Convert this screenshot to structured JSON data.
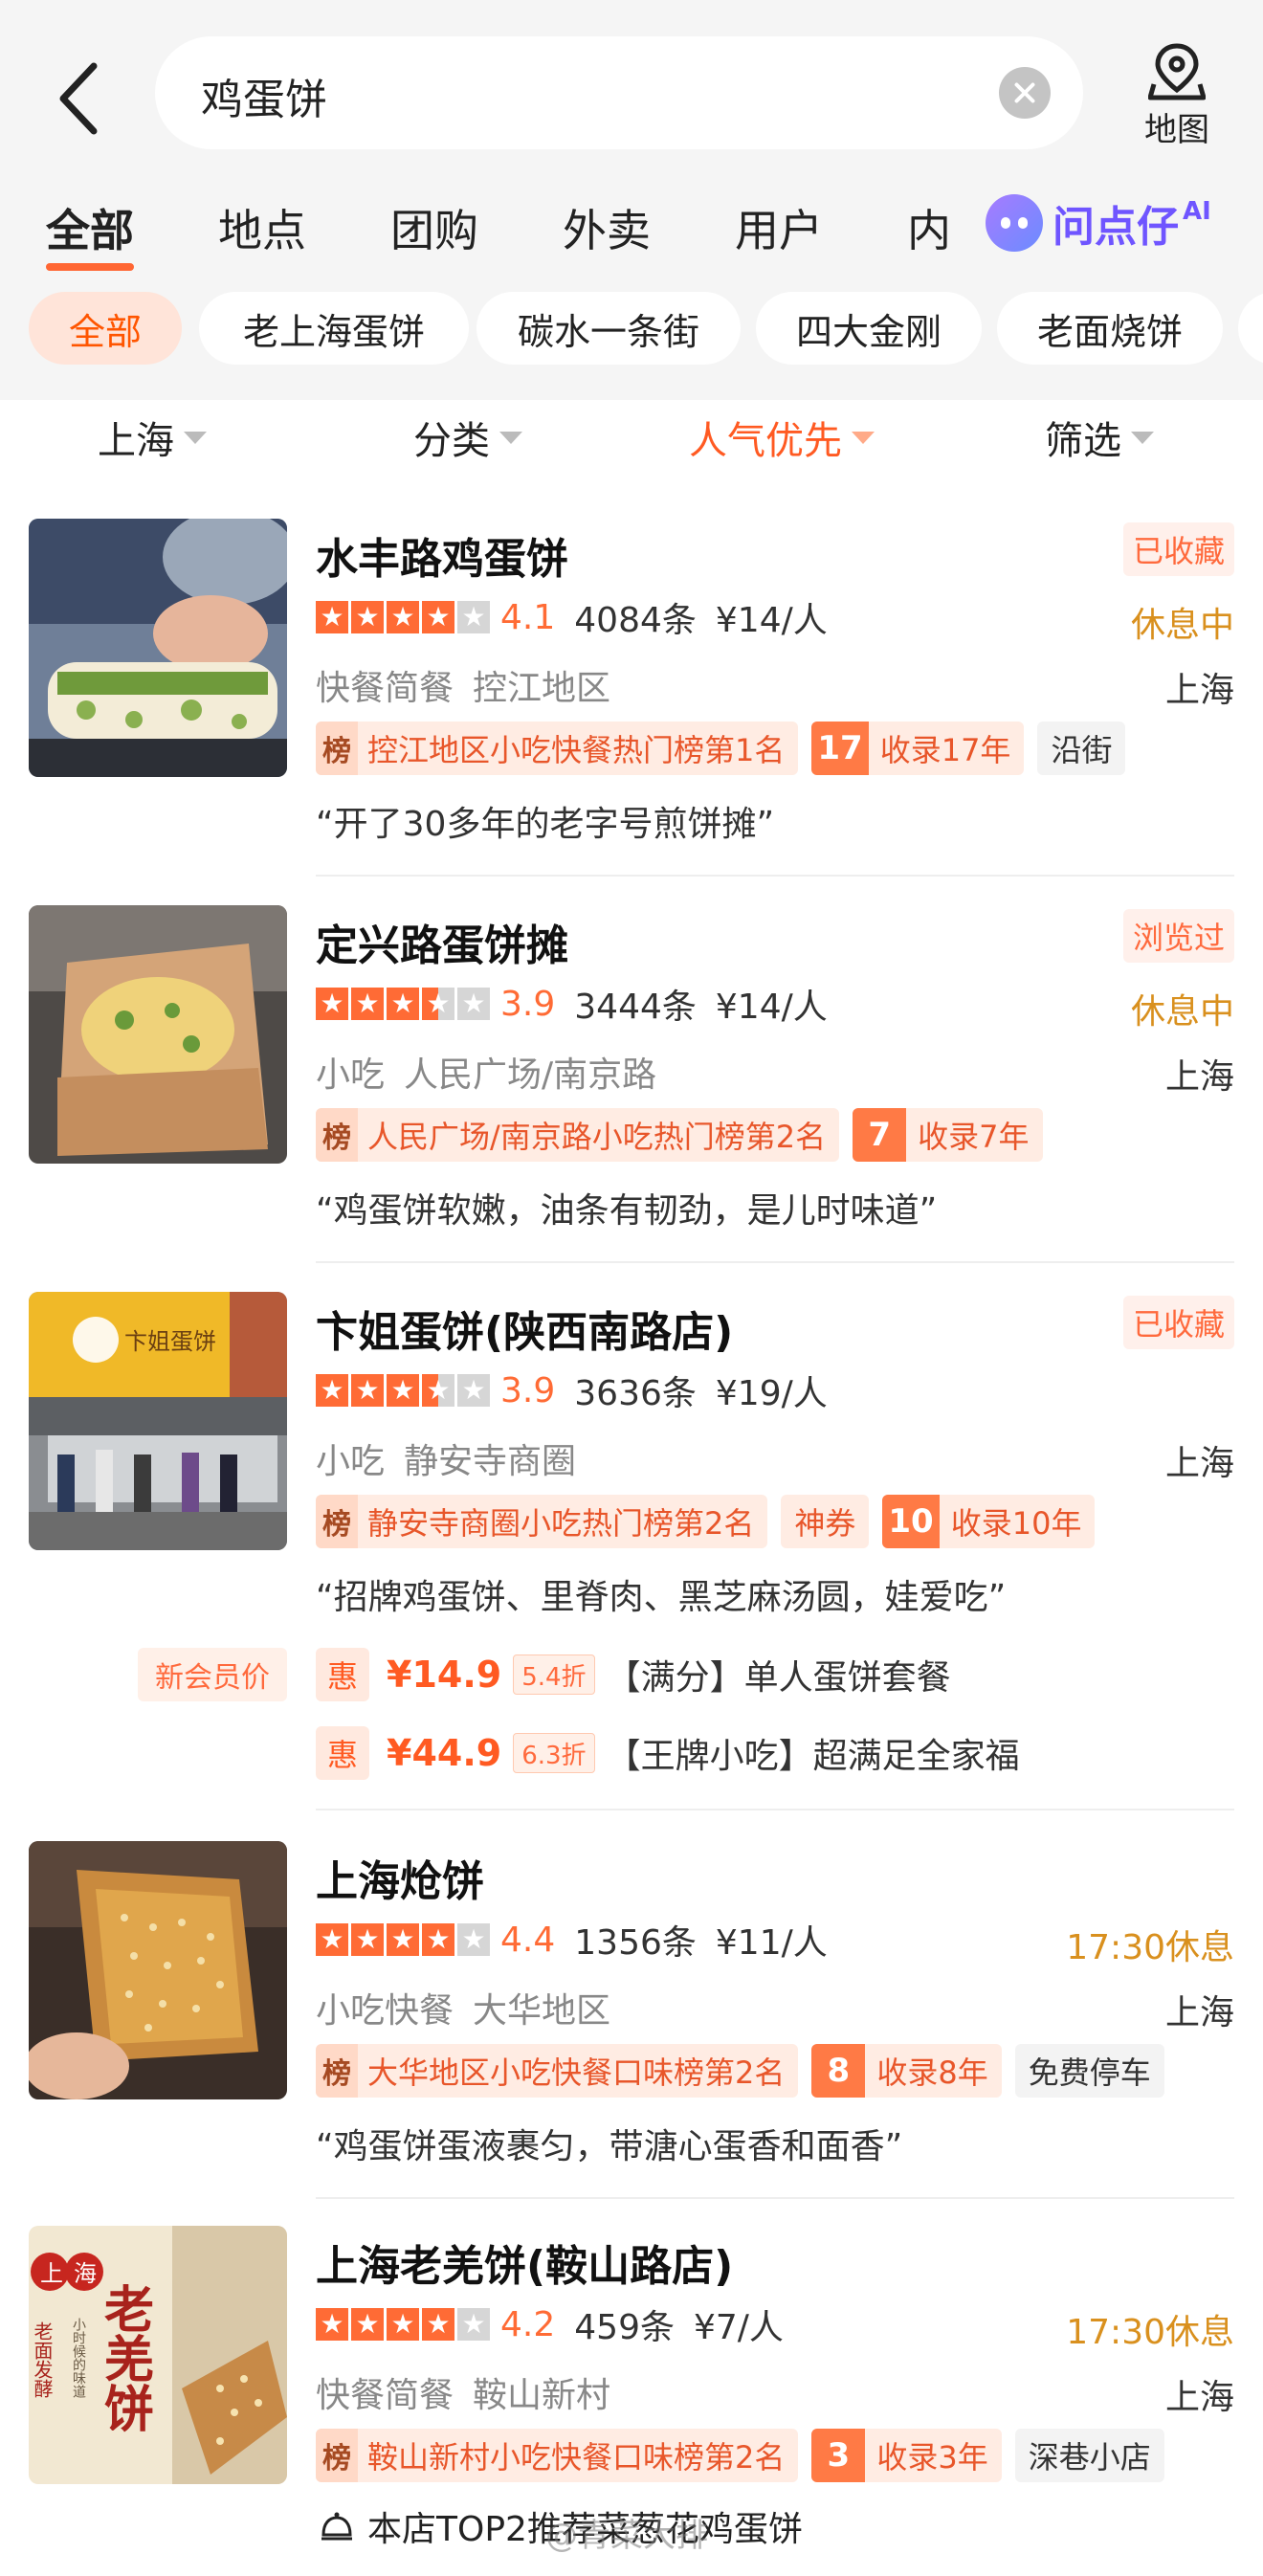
{
  "search": {
    "query": "鸡蛋饼",
    "map_label": "地图"
  },
  "tabs": [
    "全部",
    "地点",
    "团购",
    "外卖",
    "用户",
    "内"
  ],
  "ai_tab": {
    "label": "问点仔",
    "sup": "AI"
  },
  "chips": [
    "全部",
    "老上海蛋饼",
    "碳水一条街",
    "四大金刚",
    "老面烧饼"
  ],
  "filters": [
    "上海",
    "分类",
    "人气优先",
    "筛选"
  ],
  "items": [
    {
      "name": "水丰路鸡蛋饼",
      "flag": "已收藏",
      "rating": 4.1,
      "score": "4.1",
      "reviews": "4084条",
      "price": "¥14/人",
      "status": "休息中",
      "category": "快餐简餐",
      "area": "控江地区",
      "city": "上海",
      "rank_icon": "榜",
      "rank": "控江地区小吃快餐热门榜第1名",
      "years_num": "17",
      "years": "收录17年",
      "extra_tag": "沿街",
      "quote": "“开了30多年的老字号煎饼摊”"
    },
    {
      "name": "定兴路蛋饼摊",
      "flag": "浏览过",
      "rating": 3.9,
      "score": "3.9",
      "reviews": "3444条",
      "price": "¥14/人",
      "status": "休息中",
      "category": "小吃",
      "area": "人民广场/南京路",
      "city": "上海",
      "rank_icon": "榜",
      "rank": "人民广场/南京路小吃热门榜第2名",
      "years_num": "7",
      "years": "收录7年",
      "quote": "“鸡蛋饼软嫩，油条有韧劲，是儿时味道”"
    },
    {
      "name": "卞姐蛋饼(陕西南路店)",
      "flag": "已收藏",
      "rating": 3.9,
      "score": "3.9",
      "reviews": "3636条",
      "price": "¥19/人",
      "category": "小吃",
      "area": "静安寺商圈",
      "city": "上海",
      "rank_icon": "榜",
      "rank": "静安寺商圈小吃热门榜第2名",
      "coupon": "神券",
      "years_num": "10",
      "years": "收录10年",
      "quote": "“招牌鸡蛋饼、里脊肉、黑芝麻汤圆，娃爱吃”",
      "member_label": "新会员价",
      "deals": [
        {
          "hui": "惠",
          "price": "¥14.9",
          "discount": "5.4折",
          "title": "【满分】单人蛋饼套餐"
        },
        {
          "hui": "惠",
          "price": "¥44.9",
          "discount": "6.3折",
          "title": "【王牌小吃】超满足全家福"
        }
      ],
      "thumb_sign": "卞姐蛋饼"
    },
    {
      "name": "上海炝饼",
      "rating": 4.4,
      "score": "4.4",
      "reviews": "1356条",
      "price": "¥11/人",
      "status": "17:30休息",
      "category": "小吃快餐",
      "area": "大华地区",
      "city": "上海",
      "rank_icon": "榜",
      "rank": "大华地区小吃快餐口味榜第2名",
      "years_num": "8",
      "years": "收录8年",
      "extra_tag": "免费停车",
      "quote": "“鸡蛋饼蛋液裹匀，带溏心蛋香和面香”"
    },
    {
      "name": "上海老羌饼(鞍山路店)",
      "rating": 4.2,
      "score": "4.2",
      "reviews": "459条",
      "price": "¥7/人",
      "status": "17:30休息",
      "category": "快餐简餐",
      "area": "鞍山新村",
      "city": "上海",
      "rank_icon": "榜",
      "rank": "鞍山新村小吃快餐口味榜第2名",
      "years_num": "3",
      "years": "收录3年",
      "extra_tag": "深巷小店",
      "recommend": "本店TOP2推荐菜葱花鸡蛋饼",
      "thumb_texts": {
        "shang": "上",
        "hai": "海",
        "big": "老羌饼",
        "side": "老面发酵",
        "sub": "小时候的味道"
      }
    }
  ],
  "watermark": "@青菜大排",
  "colors": {
    "accent": "#ff6633",
    "star": "#ff6b35",
    "status": "#d9901e",
    "ai": "#6f55ff"
  }
}
